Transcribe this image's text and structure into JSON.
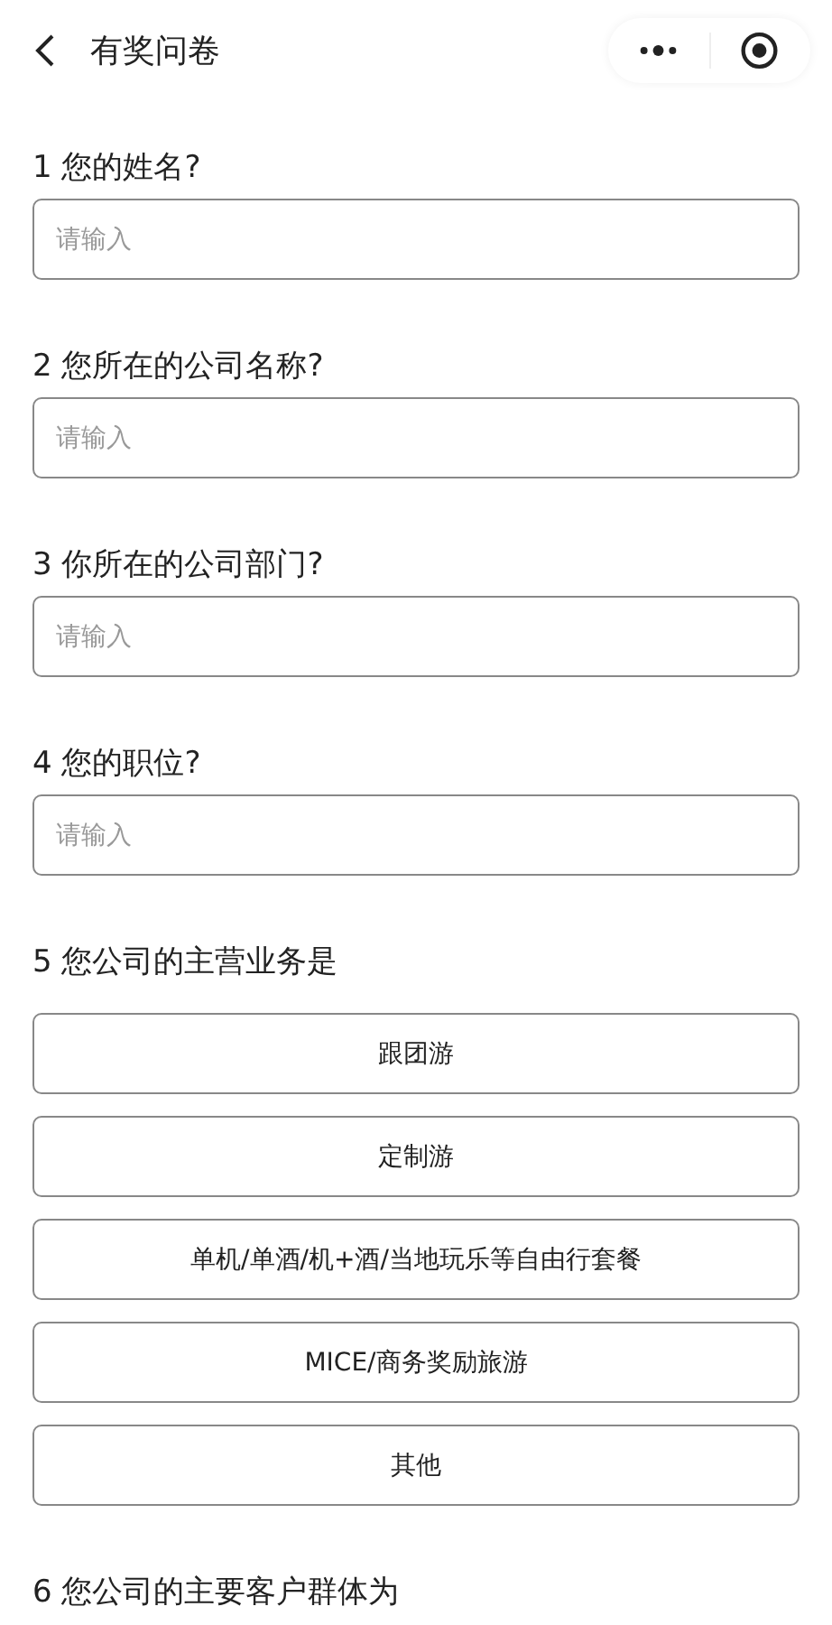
{
  "header": {
    "title": "有奖问卷"
  },
  "questions": [
    {
      "kind": "text",
      "label": "1 您的姓名?",
      "placeholder": "请输入"
    },
    {
      "kind": "text",
      "label": "2 您所在的公司名称?",
      "placeholder": "请输入"
    },
    {
      "kind": "text",
      "label": "3 你所在的公司部门?",
      "placeholder": "请输入"
    },
    {
      "kind": "text",
      "label": "4 您的职位?",
      "placeholder": "请输入"
    },
    {
      "kind": "choice",
      "label": "5 您公司的主营业务是",
      "options": [
        "跟团游",
        "定制游",
        "单机/单酒/机+酒/当地玩乐等自由行套餐",
        "MICE/商务奖励旅游",
        "其他"
      ]
    },
    {
      "kind": "heading",
      "label": "6 您公司的主要客户群体为"
    }
  ]
}
